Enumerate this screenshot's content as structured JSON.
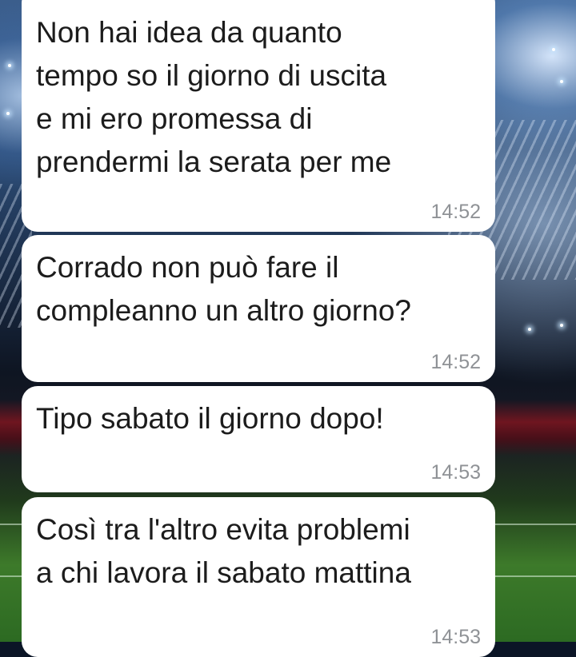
{
  "chat": {
    "messages": [
      {
        "text": "Non hai idea da quanto\ntempo so il giorno di uscita\ne mi ero promessa di\nprendermi la serata per me",
        "time": "14:52"
      },
      {
        "text": "Corrado non può fare il\ncompleanno un altro giorno?",
        "time": "14:52"
      },
      {
        "text": "Tipo sabato il giorno dopo!",
        "time": "14:53"
      },
      {
        "text": "Così tra l'altro evita problemi\na chi lavora il sabato mattina",
        "time": "14:53"
      }
    ]
  },
  "colors": {
    "bubble_background": "#ffffff",
    "message_text": "#1c1c1c",
    "timestamp_text": "#8f9296"
  },
  "wallpaper": {
    "theme": "stadium at night"
  }
}
